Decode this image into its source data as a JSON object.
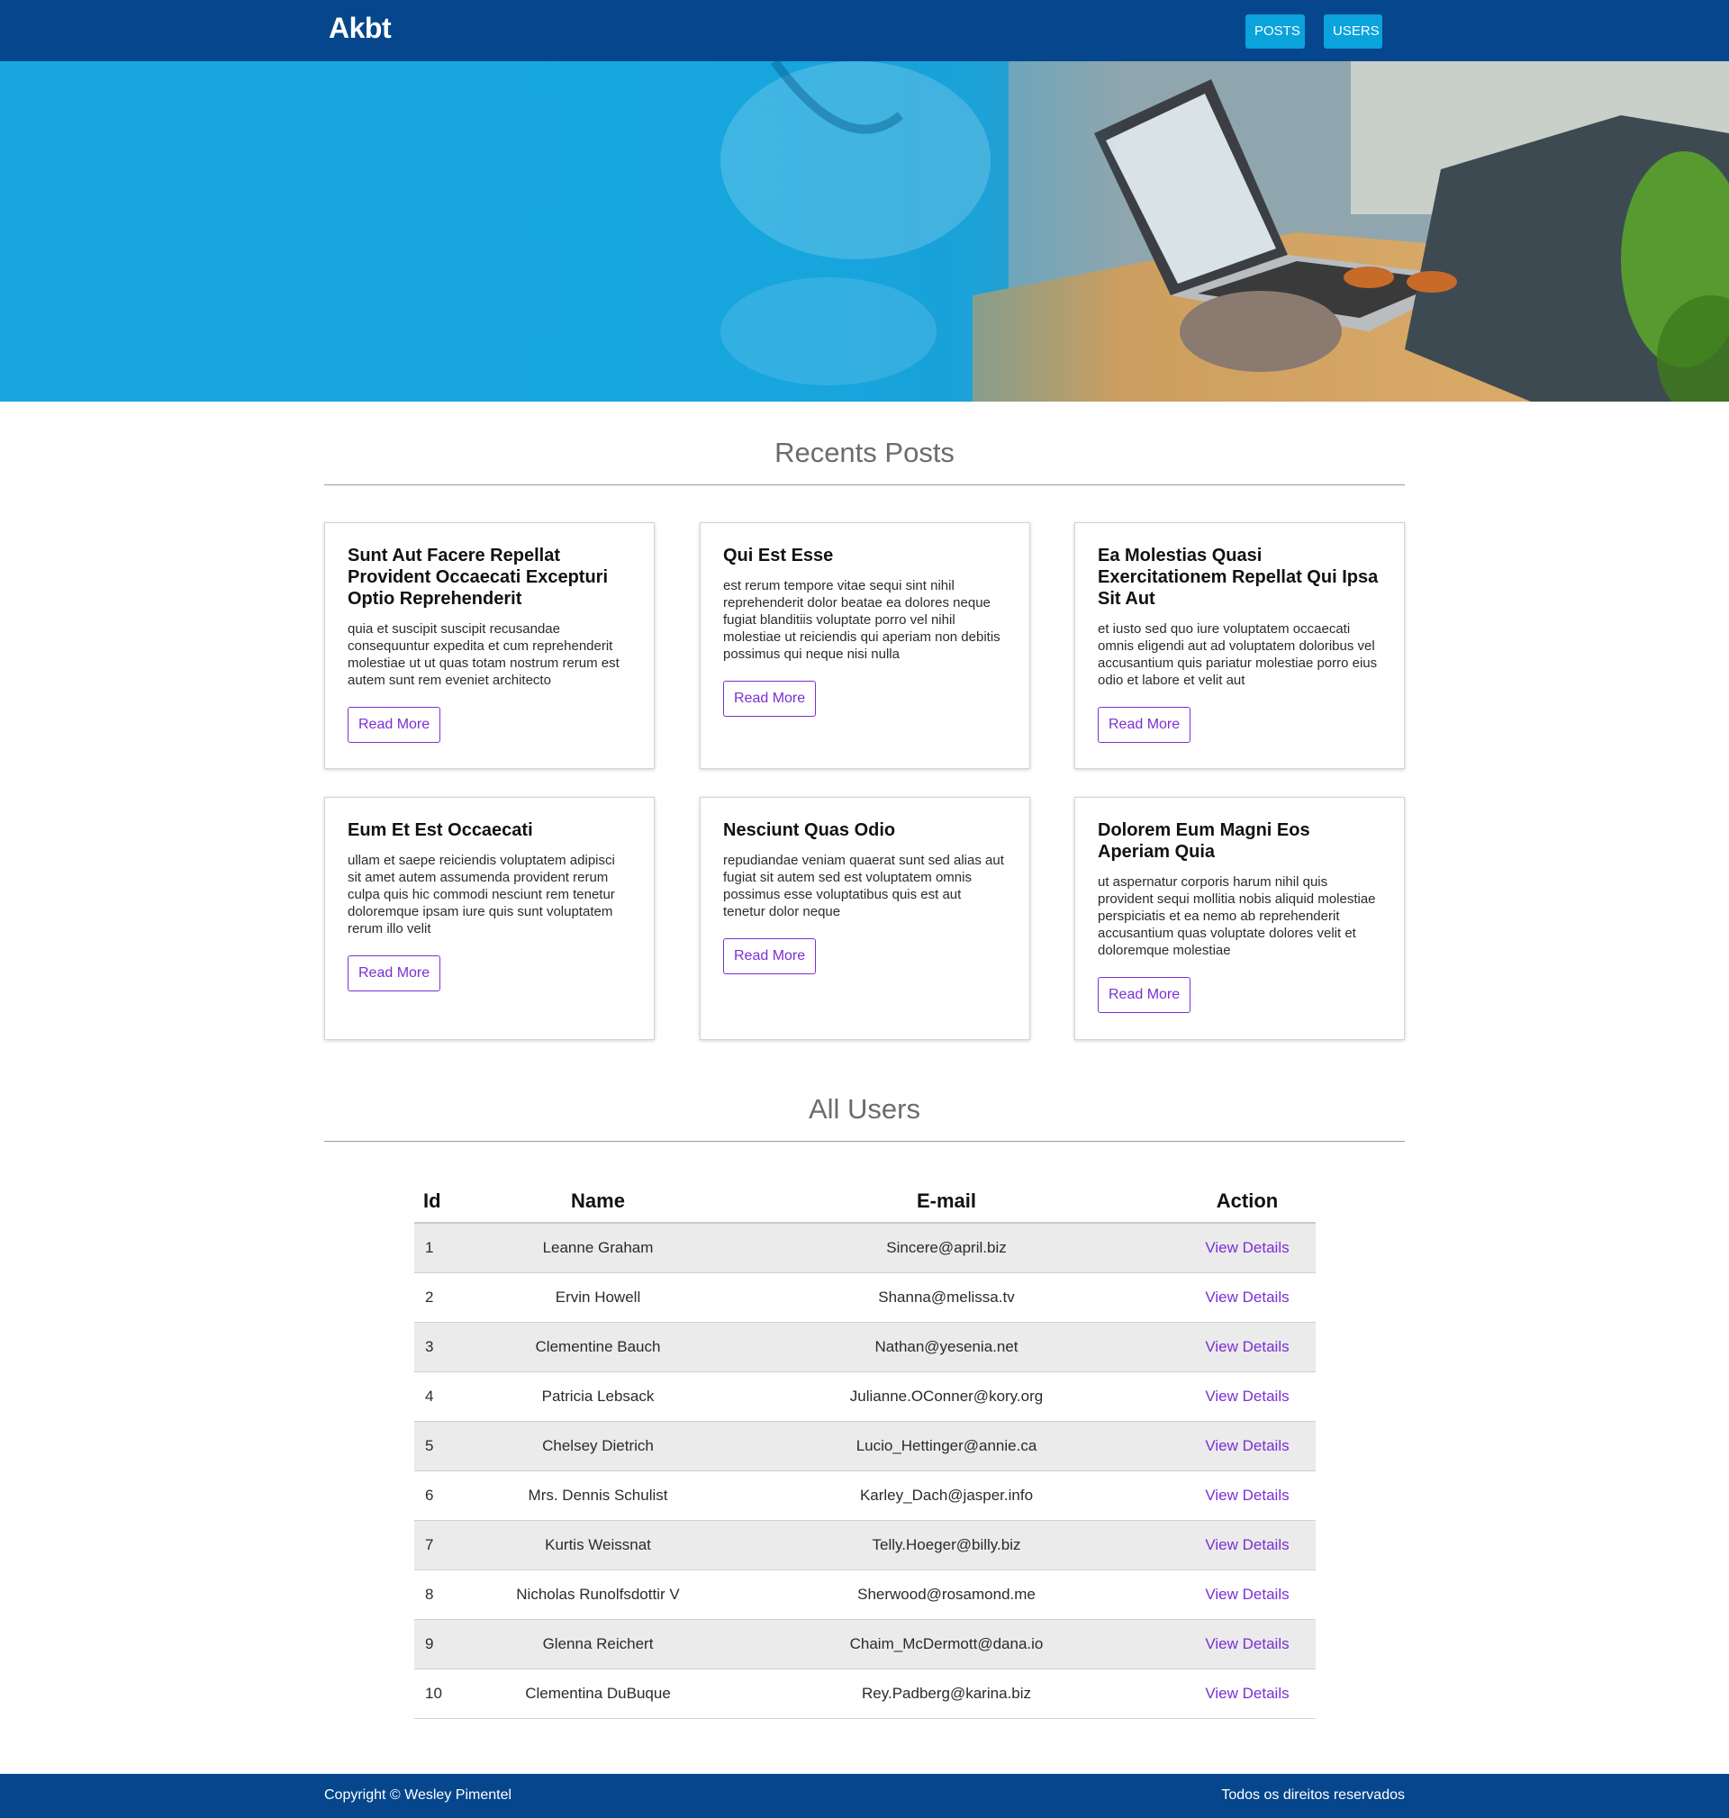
{
  "header": {
    "brand": "Akbt",
    "nav": {
      "posts": "POSTS",
      "users": "USERS"
    }
  },
  "posts_section": {
    "title": "Recents Posts",
    "read_more_label": "Read More",
    "posts": [
      {
        "title": "Sunt Aut Facere Repellat Provident Occaecati Excepturi Optio Reprehenderit",
        "body": "quia et suscipit suscipit recusandae consequuntur expedita et cum reprehenderit molestiae ut ut quas totam nostrum rerum est autem sunt rem eveniet architecto"
      },
      {
        "title": "Qui Est Esse",
        "body": "est rerum tempore vitae sequi sint nihil reprehenderit dolor beatae ea dolores neque fugiat blanditiis voluptate porro vel nihil molestiae ut reiciendis qui aperiam non debitis possimus qui neque nisi nulla"
      },
      {
        "title": "Ea Molestias Quasi Exercitationem Repellat Qui Ipsa Sit Aut",
        "body": "et iusto sed quo iure voluptatem occaecati omnis eligendi aut ad voluptatem doloribus vel accusantium quis pariatur molestiae porro eius odio et labore et velit aut"
      },
      {
        "title": "Eum Et Est Occaecati",
        "body": "ullam et saepe reiciendis voluptatem adipisci sit amet autem assumenda provident rerum culpa quis hic commodi nesciunt rem tenetur doloremque ipsam iure quis sunt voluptatem rerum illo velit"
      },
      {
        "title": "Nesciunt Quas Odio",
        "body": "repudiandae veniam quaerat sunt sed alias aut fugiat sit autem sed est voluptatem omnis possimus esse voluptatibus quis est aut tenetur dolor neque"
      },
      {
        "title": "Dolorem Eum Magni Eos Aperiam Quia",
        "body": "ut aspernatur corporis harum nihil quis provident sequi mollitia nobis aliquid molestiae perspiciatis et ea nemo ab reprehenderit accusantium quas voluptate dolores velit et doloremque molestiae"
      }
    ]
  },
  "users_section": {
    "title": "All Users",
    "columns": {
      "id": "Id",
      "name": "Name",
      "email": "E-mail",
      "action": "Action"
    },
    "action_label": "View Details",
    "rows": [
      {
        "id": "1",
        "name": "Leanne Graham",
        "email": "Sincere@april.biz"
      },
      {
        "id": "2",
        "name": "Ervin Howell",
        "email": "Shanna@melissa.tv"
      },
      {
        "id": "3",
        "name": "Clementine Bauch",
        "email": "Nathan@yesenia.net"
      },
      {
        "id": "4",
        "name": "Patricia Lebsack",
        "email": "Julianne.OConner@kory.org"
      },
      {
        "id": "5",
        "name": "Chelsey Dietrich",
        "email": "Lucio_Hettinger@annie.ca"
      },
      {
        "id": "6",
        "name": "Mrs. Dennis Schulist",
        "email": "Karley_Dach@jasper.info"
      },
      {
        "id": "7",
        "name": "Kurtis Weissnat",
        "email": "Telly.Hoeger@billy.biz"
      },
      {
        "id": "8",
        "name": "Nicholas Runolfsdottir V",
        "email": "Sherwood@rosamond.me"
      },
      {
        "id": "9",
        "name": "Glenna Reichert",
        "email": "Chaim_McDermott@dana.io"
      },
      {
        "id": "10",
        "name": "Clementina DuBuque",
        "email": "Rey.Padberg@karina.biz"
      }
    ]
  },
  "footer": {
    "copyright": "Copyright © Wesley Pimentel",
    "rights": "Todos os direitos reservados"
  },
  "colors": {
    "header_bg": "#05468c",
    "nav_button_bg": "#0aa3dc",
    "accent_purple": "#7b2fd4",
    "table_stripe": "#ebebeb"
  }
}
